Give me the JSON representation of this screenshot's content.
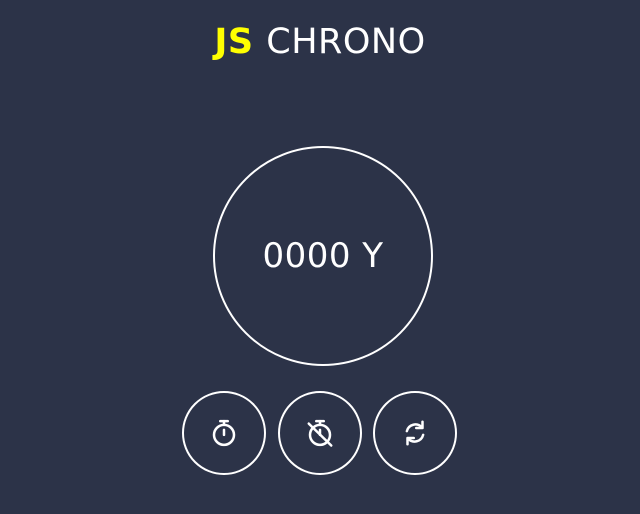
{
  "header": {
    "title_accent": "JS",
    "title_rest": "CHRONO"
  },
  "display": {
    "time": "0000 Y"
  },
  "controls": [
    {
      "icon": "stopwatch-icon"
    },
    {
      "icon": "stopwatch-slash-icon"
    },
    {
      "icon": "refresh-icon"
    }
  ],
  "colors": {
    "background": "#2c3348",
    "accent": "#ffff00",
    "foreground": "#ffffff"
  }
}
